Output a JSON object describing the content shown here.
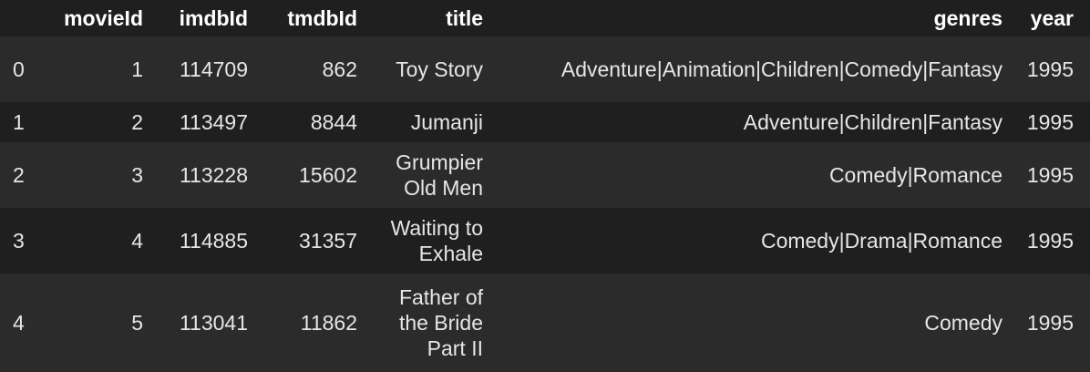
{
  "dataframe": {
    "columns": [
      "movieId",
      "imdbId",
      "tmdbId",
      "title",
      "genres",
      "year"
    ],
    "rows": [
      {
        "index": "0",
        "movieId": "1",
        "imdbId": "114709",
        "tmdbId": "862",
        "title": "Toy Story",
        "genres": "Adventure|Animation|Children|Comedy|Fantasy",
        "year": "1995"
      },
      {
        "index": "1",
        "movieId": "2",
        "imdbId": "113497",
        "tmdbId": "8844",
        "title": "Jumanji",
        "genres": "Adventure|Children|Fantasy",
        "year": "1995"
      },
      {
        "index": "2",
        "movieId": "3",
        "imdbId": "113228",
        "tmdbId": "15602",
        "title": "Grumpier Old Men",
        "genres": "Comedy|Romance",
        "year": "1995"
      },
      {
        "index": "3",
        "movieId": "4",
        "imdbId": "114885",
        "tmdbId": "31357",
        "title": "Waiting to Exhale",
        "genres": "Comedy|Drama|Romance",
        "year": "1995"
      },
      {
        "index": "4",
        "movieId": "5",
        "imdbId": "113041",
        "tmdbId": "11862",
        "title": "Father of the Bride Part II",
        "genres": "Comedy",
        "year": "1995"
      }
    ]
  },
  "colors": {
    "background": "#1f1f1f",
    "stripe": "#2b2b2b",
    "text": "#e6e6e6",
    "header_text": "#ffffff"
  }
}
